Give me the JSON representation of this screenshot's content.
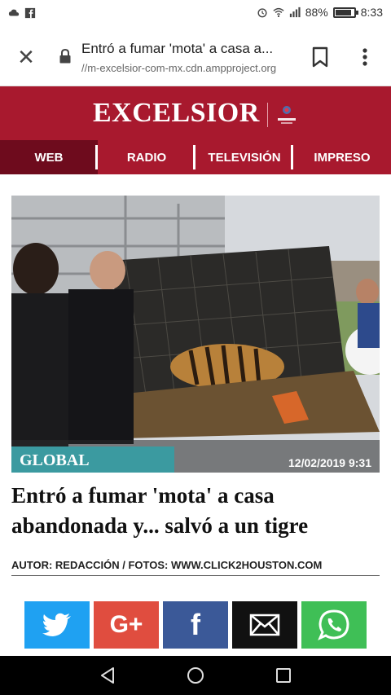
{
  "status_bar": {
    "battery_percent": "88%",
    "battery_level": 0.88,
    "time": "8:33",
    "icons": [
      "cloud-icon",
      "facebook-icon",
      "alarm-icon",
      "wifi-icon",
      "signal-icon",
      "battery-icon"
    ]
  },
  "browser": {
    "title": "Entró a fumar 'mota' a casa a...",
    "url": "//m-excelsior-com-mx.cdn.ampproject.org"
  },
  "site": {
    "logo": "EXCELSIOR",
    "colors": {
      "brand": "#a8192e",
      "nav_active": "#6e0b1d"
    }
  },
  "nav": {
    "items": [
      {
        "label": "WEB",
        "active": true
      },
      {
        "label": "RADIO",
        "active": false
      },
      {
        "label": "TELEVISIÓN",
        "active": false
      },
      {
        "label": "IMPRESO",
        "active": false
      }
    ]
  },
  "article": {
    "section": "GLOBAL",
    "date": "12/02/2019 9:31",
    "headline": "Entró a fumar 'mota' a casa abandonada y... salvó a un tigre",
    "author": "AUTOR: REDACCIÓN / FOTOS: WWW.CLICK2HOUSTON.COM"
  },
  "share": {
    "buttons": [
      "twitter-icon",
      "google-plus-icon",
      "facebook-icon",
      "email-icon",
      "whatsapp-icon"
    ],
    "google_plus_label": "G+",
    "facebook_label": "f"
  }
}
